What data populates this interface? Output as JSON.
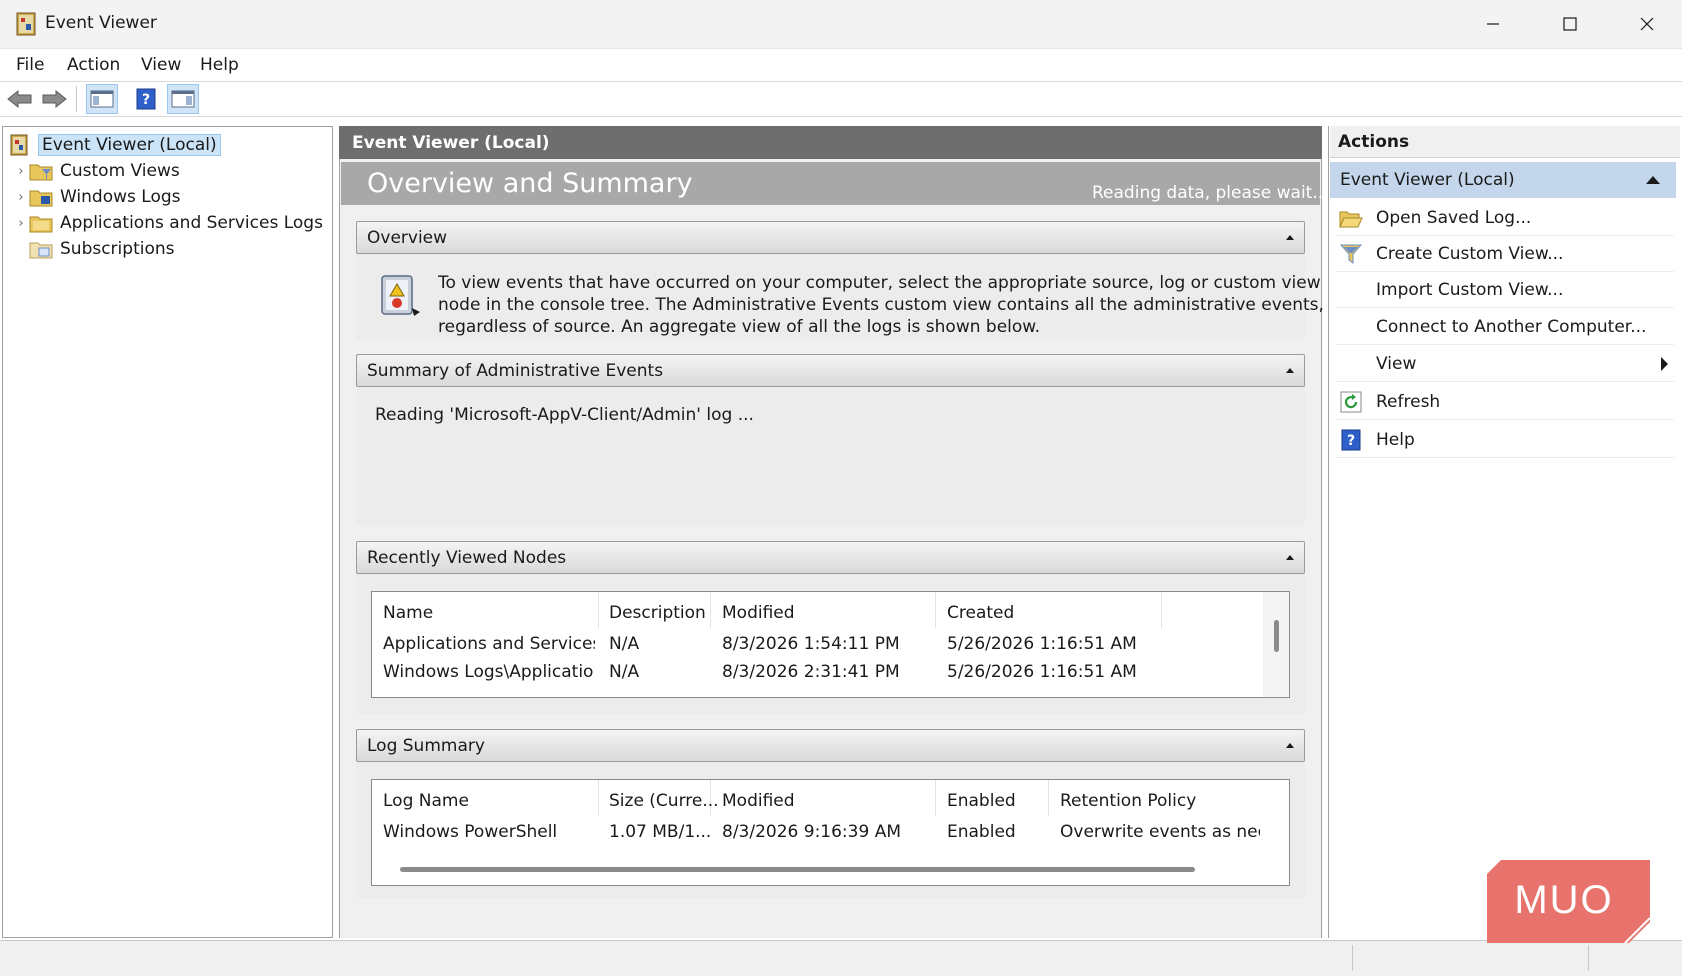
{
  "window": {
    "title": "Event Viewer",
    "controls": {
      "minimize": "minimize-icon",
      "maximize": "maximize-icon",
      "close": "close-icon"
    }
  },
  "menu": [
    "File",
    "Action",
    "View",
    "Help"
  ],
  "toolbar": {
    "icons": [
      "back-arrow-icon",
      "forward-arrow-icon",
      "show-hide-console-tree-icon",
      "help-icon",
      "show-hide-action-pane-icon"
    ]
  },
  "tree": {
    "root": "Event Viewer (Local)",
    "items": [
      {
        "label": "Custom Views",
        "expandable": true
      },
      {
        "label": "Windows Logs",
        "expandable": true
      },
      {
        "label": "Applications and Services Logs",
        "expandable": true
      },
      {
        "label": "Subscriptions",
        "expandable": false
      }
    ]
  },
  "center": {
    "header": "Event Viewer (Local)",
    "banner_title": "Overview and Summary",
    "banner_status": "Reading data, please wait...",
    "overview": {
      "title": "Overview",
      "text_line1": "To view events that have occurred on your computer, select the appropriate source, log or custom view",
      "text_line2": "node in the console tree. The Administrative Events custom view contains all the administrative events,",
      "text_line3": "regardless of source. An aggregate view of all the logs is shown below."
    },
    "summary": {
      "title": "Summary of Administrative Events",
      "status": "Reading 'Microsoft-AppV-Client/Admin' log ..."
    },
    "recent": {
      "title": "Recently Viewed Nodes",
      "columns": [
        "Name",
        "Description",
        "Modified",
        "Created"
      ],
      "rows": [
        [
          "Applications and Services ...",
          "N/A",
          "8/3/2026 1:54:11 PM",
          "5/26/2026 1:16:51 AM"
        ],
        [
          "Windows Logs\\Application",
          "N/A",
          "8/3/2026 2:31:41 PM",
          "5/26/2026 1:16:51 AM"
        ]
      ]
    },
    "logsummary": {
      "title": "Log Summary",
      "columns": [
        "Log Name",
        "Size (Curre...",
        "Modified",
        "Enabled",
        "Retention Policy"
      ],
      "rows": [
        [
          "Windows PowerShell",
          "1.07 MB/1...",
          "8/3/2026 9:16:39 AM",
          "Enabled",
          "Overwrite events as nece..."
        ]
      ]
    }
  },
  "actions": {
    "title": "Actions",
    "group": "Event Viewer (Local)",
    "items": [
      {
        "label": "Open Saved Log...",
        "icon": "folder-open-icon"
      },
      {
        "label": "Create Custom View...",
        "icon": "filter-icon"
      },
      {
        "label": "Import Custom View...",
        "icon": ""
      },
      {
        "label": "Connect to Another Computer...",
        "icon": ""
      },
      {
        "label": "View",
        "icon": "",
        "submenu": true
      },
      {
        "label": "Refresh",
        "icon": "refresh-icon"
      },
      {
        "label": "Help",
        "icon": "help-icon"
      }
    ]
  },
  "watermark": "MUO",
  "colors": {
    "selection": "#cce4f7",
    "header_dark": "#6e6e6e",
    "banner": "#a8a8a8",
    "actions_group": "#c4d6eb",
    "badge": "#e8726c"
  }
}
